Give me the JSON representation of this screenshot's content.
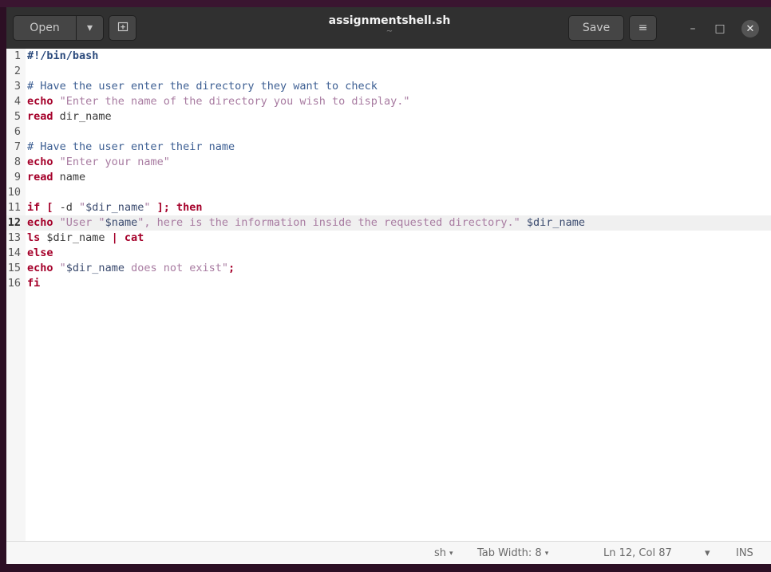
{
  "window": {
    "title": "assignmentshell.sh",
    "subtitle": "~"
  },
  "headerbar": {
    "open_label": "Open",
    "open_menu_icon": "▾",
    "new_tab_icon": "⊞",
    "save_label": "Save",
    "menu_icon": "≡",
    "minimize_icon": "–",
    "maximize_icon": "□",
    "close_icon": "✕"
  },
  "editor": {
    "current_line": 12,
    "lines": [
      {
        "n": "1",
        "tokens": [
          {
            "t": "#!/bin/bash",
            "c": "sb"
          }
        ]
      },
      {
        "n": "2",
        "tokens": []
      },
      {
        "n": "3",
        "tokens": [
          {
            "t": "# Have the user enter the directory they want to check",
            "c": "cm"
          }
        ]
      },
      {
        "n": "4",
        "tokens": [
          {
            "t": "echo",
            "c": "kw"
          },
          {
            "t": " ",
            "c": ""
          },
          {
            "t": "\"Enter the name of the directory you wish to display.\"",
            "c": "st"
          }
        ]
      },
      {
        "n": "5",
        "tokens": [
          {
            "t": "read",
            "c": "kw"
          },
          {
            "t": " dir_name",
            "c": ""
          }
        ]
      },
      {
        "n": "6",
        "tokens": []
      },
      {
        "n": "7",
        "tokens": [
          {
            "t": "# Have the user enter their name",
            "c": "cm"
          }
        ]
      },
      {
        "n": "8",
        "tokens": [
          {
            "t": "echo",
            "c": "kw"
          },
          {
            "t": " ",
            "c": ""
          },
          {
            "t": "\"Enter your name\"",
            "c": "st"
          }
        ]
      },
      {
        "n": "9",
        "tokens": [
          {
            "t": "read",
            "c": "kw"
          },
          {
            "t": " name",
            "c": ""
          }
        ]
      },
      {
        "n": "10",
        "tokens": []
      },
      {
        "n": "11",
        "tokens": [
          {
            "t": "if [",
            "c": "kw"
          },
          {
            "t": " -d ",
            "c": ""
          },
          {
            "t": "\"",
            "c": "st"
          },
          {
            "t": "$dir_name",
            "c": "vr"
          },
          {
            "t": "\"",
            "c": "st"
          },
          {
            "t": " ",
            "c": ""
          },
          {
            "t": "]; then",
            "c": "kw"
          }
        ]
      },
      {
        "n": "12",
        "tokens": [
          {
            "t": "echo",
            "c": "kw"
          },
          {
            "t": " ",
            "c": ""
          },
          {
            "t": "\"User \"",
            "c": "st"
          },
          {
            "t": "$name",
            "c": "vr"
          },
          {
            "t": "\", here is the information inside the requested directory.\"",
            "c": "st"
          },
          {
            "t": " ",
            "c": ""
          },
          {
            "t": "$dir_name",
            "c": "vr"
          }
        ]
      },
      {
        "n": "13",
        "tokens": [
          {
            "t": "ls",
            "c": "kw"
          },
          {
            "t": " $dir_name ",
            "c": ""
          },
          {
            "t": "| cat",
            "c": "kw"
          }
        ]
      },
      {
        "n": "14",
        "tokens": [
          {
            "t": "else",
            "c": "kw"
          }
        ]
      },
      {
        "n": "15",
        "tokens": [
          {
            "t": "echo",
            "c": "kw"
          },
          {
            "t": " ",
            "c": ""
          },
          {
            "t": "\"",
            "c": "st"
          },
          {
            "t": "$dir_name",
            "c": "vr"
          },
          {
            "t": " does not exist\"",
            "c": "st"
          },
          {
            "t": ";",
            "c": "kw"
          }
        ]
      },
      {
        "n": "16",
        "tokens": [
          {
            "t": "fi",
            "c": "kw"
          }
        ]
      }
    ]
  },
  "statusbar": {
    "language": "sh",
    "tab_width": "Tab Width: 8",
    "position": "Ln 12, Col 87",
    "mode": "INS",
    "dropdown_icon": "▾"
  }
}
